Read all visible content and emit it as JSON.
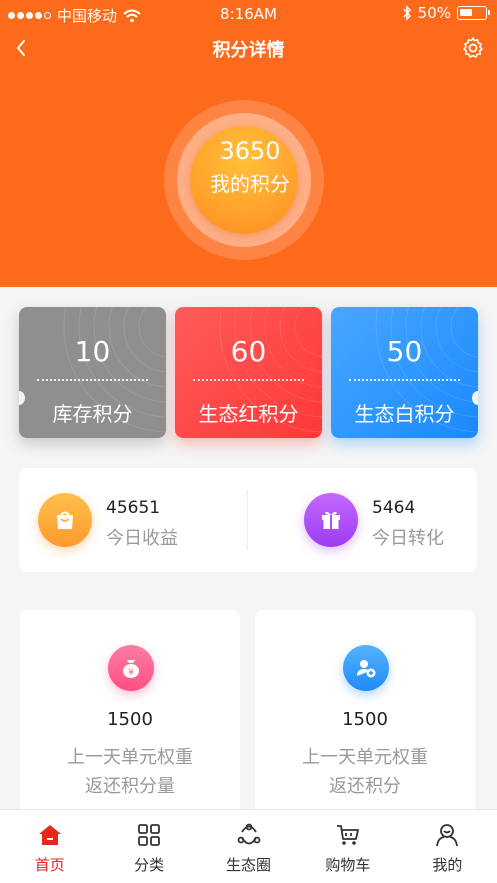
{
  "status_bar": {
    "carrier": "中国移动",
    "time": "8:16AM",
    "battery_percent": "50%"
  },
  "nav": {
    "title": "积分详情",
    "back_icon": "chevron-left-icon",
    "settings_icon": "gear-icon"
  },
  "points": {
    "value": "3650",
    "label": "我的积分"
  },
  "cards": [
    {
      "value": "10",
      "label": "库存积分",
      "color": "#8f8f8f"
    },
    {
      "value": "60",
      "label": "生态红积分",
      "color": "#ff4444"
    },
    {
      "value": "50",
      "label": "生态白积分",
      "color": "#2a93ff"
    }
  ],
  "today": [
    {
      "value": "45651",
      "label": "今日收益",
      "icon": "shopping-bag-icon"
    },
    {
      "value": "5464",
      "label": "今日转化",
      "icon": "gift-icon"
    }
  ],
  "features": [
    {
      "value": "1500",
      "line1": "上一天单元权重",
      "line2": "返还积分量",
      "icon": "money-bag-icon"
    },
    {
      "value": "1500",
      "line1": "上一天单元权重",
      "line2": "返还积分",
      "icon": "add-user-icon"
    }
  ],
  "tabbar": [
    {
      "label": "首页",
      "icon": "home-icon",
      "active": true
    },
    {
      "label": "分类",
      "icon": "grid-icon",
      "active": false
    },
    {
      "label": "生态圈",
      "icon": "ecosystem-icon",
      "active": false
    },
    {
      "label": "购物车",
      "icon": "cart-icon",
      "active": false
    },
    {
      "label": "我的",
      "icon": "user-icon",
      "active": false
    }
  ],
  "colors": {
    "header": "#fe6a1c",
    "active_tab": "#e4281b"
  }
}
